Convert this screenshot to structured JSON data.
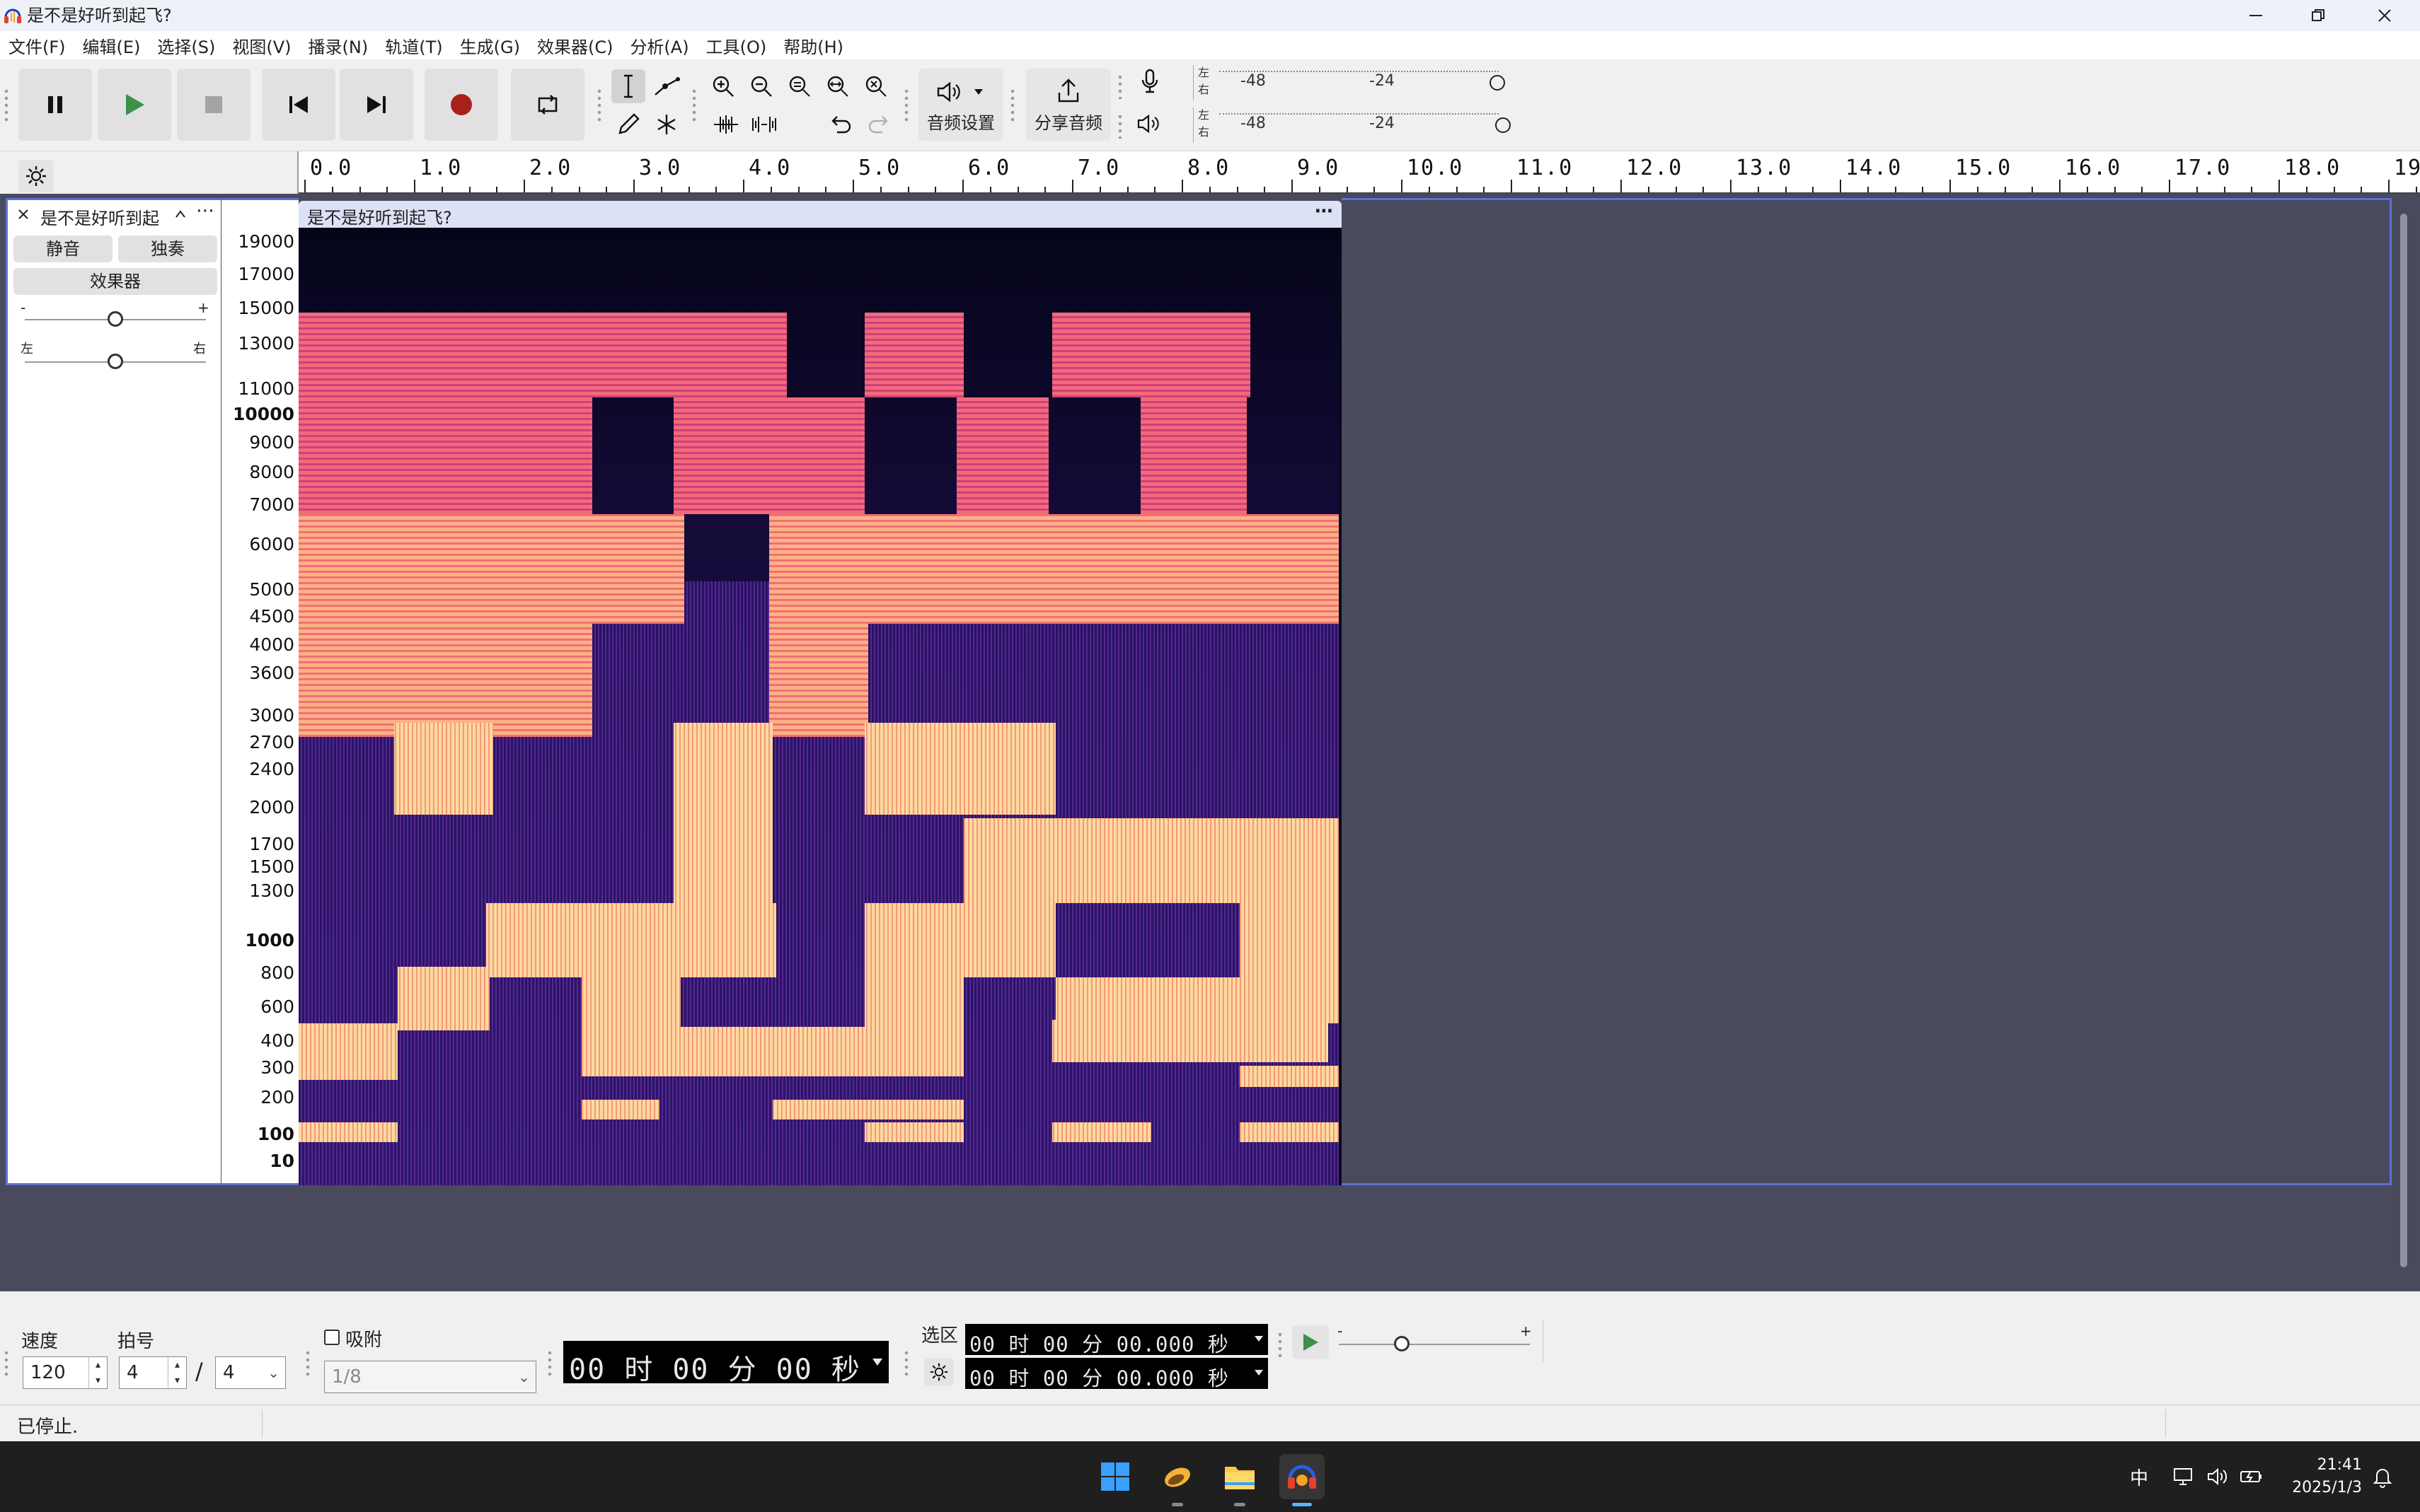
{
  "window": {
    "title": "是不是好听到起飞?"
  },
  "menu": [
    "文件(F)",
    "编辑(E)",
    "选择(S)",
    "视图(V)",
    "播录(N)",
    "轨道(T)",
    "生成(G)",
    "效果器(C)",
    "分析(A)",
    "工具(O)",
    "帮助(H)"
  ],
  "toolbar": {
    "audio_setup_label": "音频设置",
    "share_audio_label": "分享音频",
    "meter_channels": [
      "左",
      "右"
    ],
    "meter_ticks": [
      "-48",
      "-24"
    ]
  },
  "ruler": {
    "labels": [
      "0.0",
      "1.0",
      "2.0",
      "3.0",
      "4.0",
      "5.0",
      "6.0",
      "7.0",
      "8.0",
      "9.0",
      "10.0",
      "11.0",
      "12.0",
      "13.0",
      "14.0",
      "15.0",
      "16.0",
      "17.0",
      "18.0",
      "19.0"
    ]
  },
  "track": {
    "name": "是不是好听到起",
    "mute_label": "静音",
    "solo_label": "独奏",
    "effects_label": "效果器",
    "gain_minus": "-",
    "gain_plus": "+",
    "pan_left": "左",
    "pan_right": "右",
    "gain_level": 0.5,
    "pan_level": 0.5,
    "clip_name": "是不是好听到起飞?",
    "clip_menu": "⋯"
  },
  "frequency_scale": [
    {
      "label": "19000",
      "bold": false
    },
    {
      "label": "17000",
      "bold": false
    },
    {
      "label": "15000",
      "bold": false
    },
    {
      "label": "13000",
      "bold": false
    },
    {
      "label": "11000",
      "bold": false
    },
    {
      "label": "10000",
      "bold": true
    },
    {
      "label": "9000",
      "bold": false
    },
    {
      "label": "8000",
      "bold": false
    },
    {
      "label": "7000",
      "bold": false
    },
    {
      "label": "6000",
      "bold": false
    },
    {
      "label": "5000",
      "bold": false
    },
    {
      "label": "4500",
      "bold": false
    },
    {
      "label": "4000",
      "bold": false
    },
    {
      "label": "3600",
      "bold": false
    },
    {
      "label": "3000",
      "bold": false
    },
    {
      "label": "2700",
      "bold": false
    },
    {
      "label": "2400",
      "bold": false
    },
    {
      "label": "2000",
      "bold": false
    },
    {
      "label": "1700",
      "bold": false
    },
    {
      "label": "1500",
      "bold": false
    },
    {
      "label": "1300",
      "bold": false
    },
    {
      "label": "1000",
      "bold": true
    },
    {
      "label": "800",
      "bold": false
    },
    {
      "label": "600",
      "bold": false
    },
    {
      "label": "400",
      "bold": false
    },
    {
      "label": "300",
      "bold": false
    },
    {
      "label": "200",
      "bold": false
    },
    {
      "label": "100",
      "bold": true
    },
    {
      "label": "10",
      "bold": true
    }
  ],
  "bottom": {
    "tempo_label": "速度",
    "tempo_value": "120",
    "time_sig_label": "拍号",
    "time_sig_top": "4",
    "time_sig_slash": "/",
    "time_sig_bottom": "4",
    "snap_label": "吸附",
    "snap_value": "1/8",
    "time_display": "00 时 00 分 00 秒",
    "selection_label": "选区",
    "selection_start": "00 时 00 分 00.000 秒",
    "selection_end": "00 时 00 分 00.000 秒",
    "play_speed_minus": "-",
    "play_speed_plus": "+",
    "play_speed_level": 0.33
  },
  "status": {
    "text": "已停止."
  },
  "taskbar": {
    "ime": "中",
    "time": "21:41",
    "date": "2025/1/3"
  },
  "colors": {
    "selected_track_border": "#5f6fd6",
    "track_background": "#494a5c",
    "play_green": "#3d8f4a",
    "record_red": "#a8201a"
  }
}
